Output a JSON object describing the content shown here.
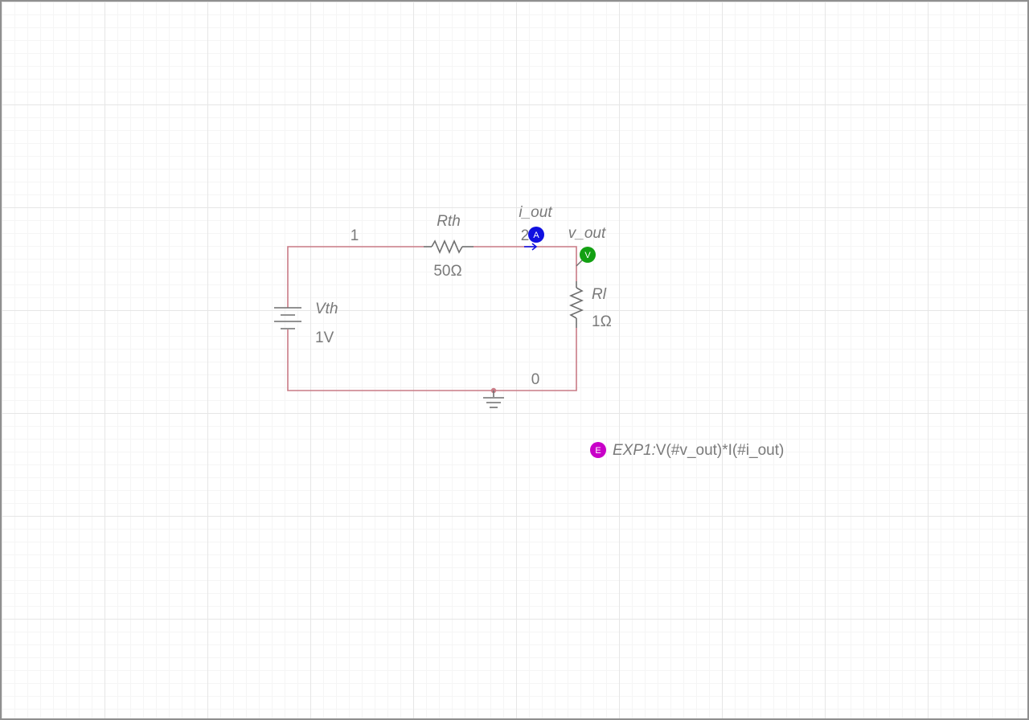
{
  "colors": {
    "wire": "#c97b86",
    "component": "#6f6f6f",
    "label": "#7a7a7a",
    "ammeter": "#1010e0",
    "voltmeter": "#12a012",
    "expression": "#c800c8",
    "grid_major": "#e6e6e6",
    "grid_minor": "#f5f5f5"
  },
  "nodes": {
    "n1": "1",
    "n2": "2",
    "n0": "0"
  },
  "components": {
    "vth": {
      "name": "Vth",
      "value": "1V",
      "icon": "dc-voltage-source-icon"
    },
    "rth": {
      "name": "Rth",
      "value": "50Ω",
      "icon": "resistor-icon"
    },
    "rl": {
      "name": "Rl",
      "value": "1Ω",
      "icon": "resistor-icon"
    },
    "ground": {
      "icon": "ground-icon"
    }
  },
  "probes": {
    "current": {
      "name": "i_out",
      "badge": "A"
    },
    "voltage": {
      "name": "v_out",
      "badge": "V"
    }
  },
  "expression": {
    "badge": "E",
    "name": "EXP1:",
    "formula": "V(#v_out)*I(#i_out)"
  }
}
